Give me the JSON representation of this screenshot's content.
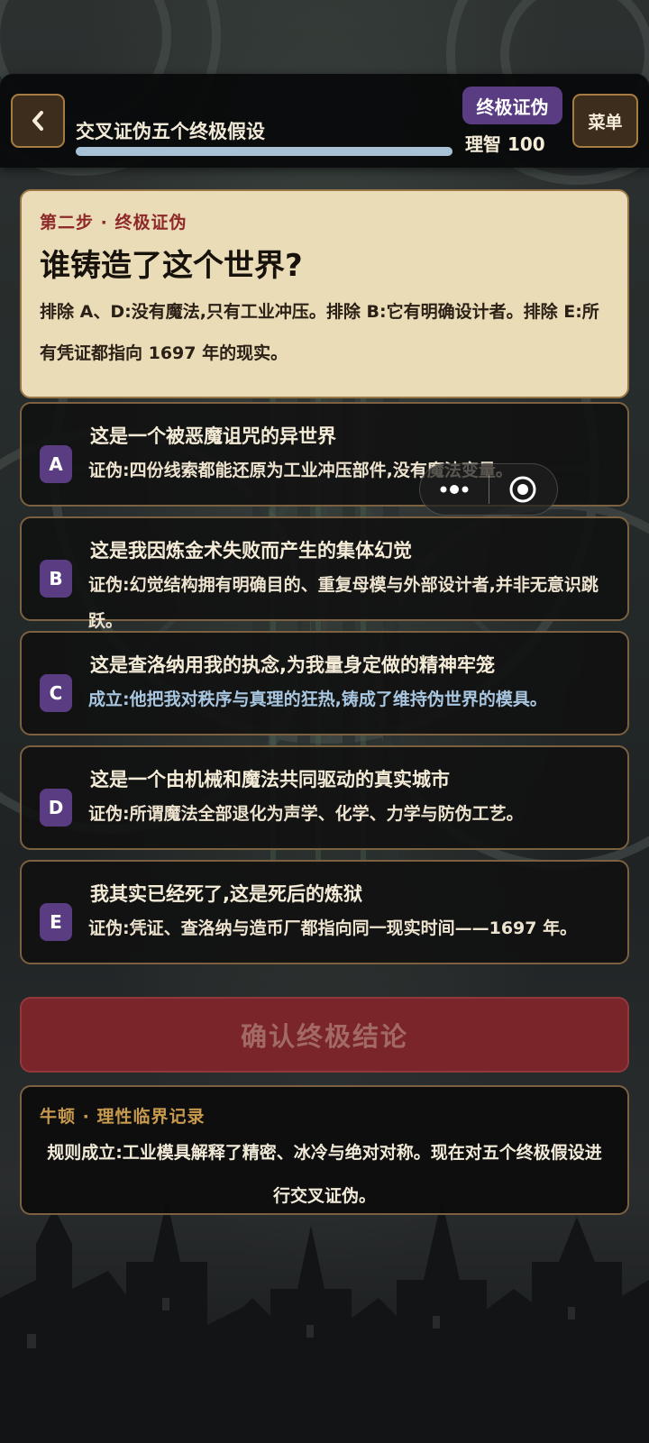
{
  "header": {
    "title": "交叉证伪五个终极假设",
    "progress": 1.0,
    "stage_badge": "终极证伪",
    "sanity": "理智 100",
    "menu_label": "菜单"
  },
  "question": {
    "step_label": "第二步 · 终极证伪",
    "title": "谁铸造了这个世界?",
    "description": "排除 A、D:没有魔法,只有工业冲压。排除 B:它有明确设计者。排除 E:所有凭证都指向 1697 年的现实。"
  },
  "options": [
    {
      "letter": "A",
      "title": "这是一个被恶魔诅咒的异世界",
      "detail": "证伪:四份线索都能还原为工业冲压部件,没有魔法变量。",
      "verdict": "falsified"
    },
    {
      "letter": "B",
      "title": "这是我因炼金术失败而产生的集体幻觉",
      "detail": "证伪:幻觉结构拥有明确目的、重复母模与外部设计者,并非无意识跳跃。",
      "verdict": "falsified"
    },
    {
      "letter": "C",
      "title": "这是查洛纳用我的执念,为我量身定做的精神牢笼",
      "detail": "成立:他把我对秩序与真理的狂热,铸成了维持伪世界的模具。",
      "verdict": "confirmed"
    },
    {
      "letter": "D",
      "title": "这是一个由机械和魔法共同驱动的真实城市",
      "detail": "证伪:所谓魔法全部退化为声学、化学、力学与防伪工艺。",
      "verdict": "falsified"
    },
    {
      "letter": "E",
      "title": "我其实已经死了,这是死后的炼狱",
      "detail": "证伪:凭证、查洛纳与造币厂都指向同一现实时间——1697 年。",
      "verdict": "falsified"
    }
  ],
  "confirm_button": "确认终极结论",
  "log": {
    "label": "牛顿 · 理性临界记录",
    "text": "规则成立:工业模具解释了精密、冰冷与绝对对称。现在对五个终极假设进行交叉证伪。"
  },
  "icons": {
    "back": "chevron-left-icon",
    "capsule_more": "more-dots-icon",
    "capsule_close": "target-close-icon"
  },
  "colors": {
    "accent_purple": "#5a3c82",
    "parchment": "#ebdcb8",
    "confirm_red": "#7a2529",
    "gold_border": "#a67c42",
    "confirmed_text": "#a8c6e0"
  }
}
